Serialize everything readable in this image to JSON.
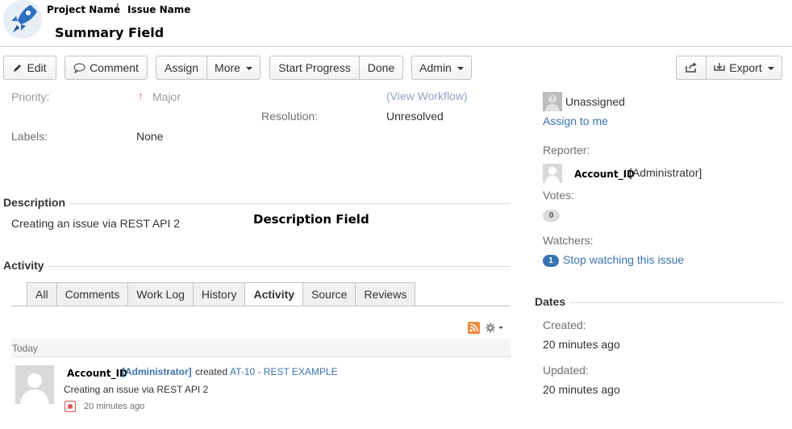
{
  "header": {
    "project_name": "Project Name",
    "separator": "/",
    "issue_name": "Issue Name",
    "summary": "Summary Field"
  },
  "toolbar": {
    "edit": "Edit",
    "comment": "Comment",
    "assign": "Assign",
    "more": "More",
    "start_progress": "Start Progress",
    "done": "Done",
    "admin": "Admin",
    "export": "Export"
  },
  "details": {
    "priority_label": "Priority:",
    "priority_value": "Major",
    "view_workflow": "(View Workflow)",
    "resolution_label": "Resolution:",
    "resolution_value": "Unresolved",
    "labels_label": "Labels:",
    "labels_value": "None"
  },
  "description": {
    "heading": "Description",
    "text": "Creating an issue via REST API 2",
    "annotation": "Description Field"
  },
  "activity": {
    "heading": "Activity",
    "tabs": [
      "All",
      "Comments",
      "Work Log",
      "History",
      "Activity",
      "Source",
      "Reviews"
    ],
    "active_tab": "Activity",
    "day_label": "Today",
    "entry": {
      "user": "Account_ID",
      "role": "[Administrator]",
      "action": "created",
      "issue_link": "AT-10 - REST EXAMPLE",
      "body": "Creating an issue via REST API 2",
      "time": "20 minutes ago"
    }
  },
  "people": {
    "assignee": "Unassigned",
    "assign_to_me": "Assign to me",
    "reporter_label": "Reporter:",
    "reporter_user": "Account_ID",
    "reporter_role": "[Administrator]",
    "votes_label": "Votes:",
    "votes_count": "0",
    "watchers_label": "Watchers:",
    "watchers_count": "1",
    "stop_watching": "Stop watching this issue"
  },
  "dates": {
    "heading": "Dates",
    "created_label": "Created:",
    "created_value": "20 minutes ago",
    "updated_label": "Updated:",
    "updated_value": "20 minutes ago"
  },
  "colors": {
    "link": "#3b73af",
    "badge_blue": "#3b73af",
    "rss": "#f0883a",
    "priority_major": "#e05a4f"
  }
}
